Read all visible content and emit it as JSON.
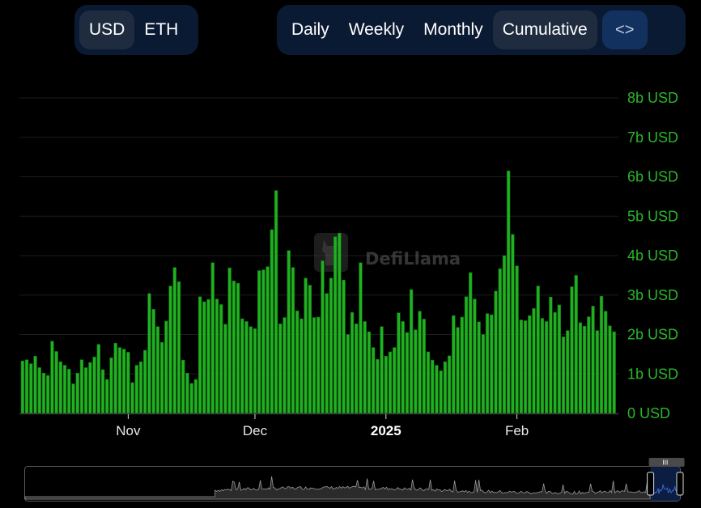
{
  "toggles": {
    "currency": [
      {
        "label": "USD",
        "active": true
      },
      {
        "label": "ETH",
        "active": false
      }
    ],
    "period": [
      {
        "label": "Daily",
        "active": false
      },
      {
        "label": "Weekly",
        "active": false
      },
      {
        "label": "Monthly",
        "active": false
      },
      {
        "label": "Cumulative",
        "active": true
      }
    ],
    "embed_icon": "code-brackets-icon",
    "embed_label": "<>"
  },
  "watermark": {
    "text": "DefiLlama",
    "icon": "llama-logo-icon"
  },
  "colors": {
    "bar": "#21b021",
    "bar_edge": "#0f6e0f",
    "axis_text": "#2ab52a",
    "grid": "#1c1c1c",
    "panel": "#0b1a33",
    "panel_active": "#1f2c40",
    "embed": "#13315f",
    "brush_fill": "#2b2b2b",
    "brush_selection": "#0f2a5c",
    "brush_line": "#3a64c8"
  },
  "brush": {
    "selection_start": 0.955,
    "selection_end": 1.0,
    "handle_label": "III"
  },
  "chart_data": {
    "type": "bar",
    "title": "",
    "xlabel": "",
    "ylabel": "",
    "unit": "USD",
    "ylim": [
      0,
      8
    ],
    "yticks": [
      {
        "v": 0,
        "label": "0 USD"
      },
      {
        "v": 1,
        "label": "1b USD"
      },
      {
        "v": 2,
        "label": "2b USD"
      },
      {
        "v": 3,
        "label": "3b USD"
      },
      {
        "v": 4,
        "label": "4b USD"
      },
      {
        "v": 5,
        "label": "5b USD"
      },
      {
        "v": 6,
        "label": "6b USD"
      },
      {
        "v": 7,
        "label": "7b USD"
      },
      {
        "v": 8,
        "label": "8b USD"
      }
    ],
    "xticks": [
      {
        "index": 25,
        "label": "Nov",
        "bold": false
      },
      {
        "index": 55,
        "label": "Dec",
        "bold": false
      },
      {
        "index": 86,
        "label": "2025",
        "bold": true
      },
      {
        "index": 117,
        "label": "Feb",
        "bold": false
      }
    ],
    "grid": true,
    "legend": "none",
    "values_billions": [
      1.33,
      1.36,
      1.26,
      1.45,
      1.16,
      1.02,
      0.96,
      1.83,
      1.57,
      1.31,
      1.22,
      1.12,
      0.75,
      1.02,
      1.36,
      1.16,
      1.29,
      1.43,
      1.75,
      1.11,
      0.86,
      1.41,
      1.78,
      1.67,
      1.63,
      1.55,
      0.78,
      1.22,
      1.31,
      1.6,
      3.04,
      2.64,
      2.2,
      1.8,
      2.34,
      3.23,
      3.7,
      3.34,
      1.35,
      1.02,
      0.76,
      0.86,
      2.96,
      2.83,
      2.89,
      3.82,
      2.9,
      2.76,
      2.26,
      3.69,
      3.36,
      3.3,
      2.4,
      2.33,
      2.2,
      2.15,
      3.62,
      3.64,
      3.72,
      4.66,
      5.65,
      2.27,
      2.43,
      4.13,
      3.7,
      2.6,
      2.4,
      3.43,
      3.25,
      2.43,
      2.44,
      3.87,
      3.04,
      3.43,
      4.48,
      4.57,
      3.38,
      2.0,
      2.56,
      2.27,
      3.82,
      2.33,
      2.07,
      1.67,
      1.37,
      2.2,
      1.45,
      1.56,
      1.67,
      2.55,
      2.33,
      2.05,
      3.14,
      2.12,
      2.59,
      2.39,
      1.56,
      1.35,
      1.22,
      1.08,
      1.31,
      1.46,
      2.48,
      2.18,
      2.44,
      2.96,
      3.57,
      2.9,
      2.32,
      2.0,
      2.53,
      2.5,
      3.1,
      3.67,
      4.0,
      6.15,
      4.54,
      3.74,
      2.37,
      2.35,
      2.48,
      2.66,
      3.23,
      2.41,
      2.33,
      2.95,
      2.56,
      2.75,
      1.94,
      2.1,
      3.21,
      3.5,
      2.3,
      2.21,
      2.45,
      2.72,
      2.1,
      2.97,
      2.59,
      2.22,
      2.07
    ]
  }
}
